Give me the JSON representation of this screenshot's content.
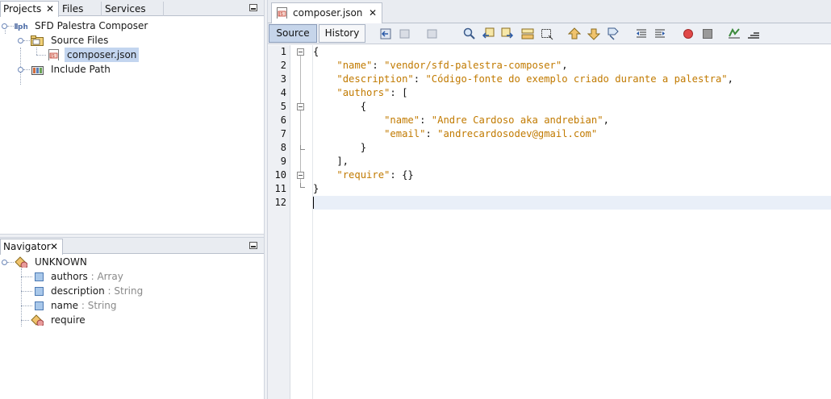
{
  "projects_panel": {
    "tabs": [
      {
        "label": "Projects",
        "close": "✕"
      },
      {
        "label": "Files"
      },
      {
        "label": "Services"
      }
    ],
    "tree": {
      "project": "SFD Palestra Composer",
      "source_files": "Source Files",
      "file": "composer.json",
      "include_path": "Include Path"
    }
  },
  "navigator_panel": {
    "title": "Navigator",
    "close": "✕",
    "root": "UNKNOWN",
    "items": [
      {
        "name": "authors",
        "type": " : Array"
      },
      {
        "name": "description",
        "type": " : String"
      },
      {
        "name": "name",
        "type": " : String"
      },
      {
        "name": "require",
        "type": ""
      }
    ]
  },
  "editor": {
    "tab_label": "composer.json",
    "tab_close": "✕",
    "source_button": "Source",
    "history_button": "History",
    "line_numbers": [
      "1",
      "2",
      "3",
      "4",
      "5",
      "6",
      "7",
      "8",
      "9",
      "10",
      "11",
      "12"
    ],
    "lines": [
      "{",
      "    \"name\": \"vendor/sfd-palestra-composer\",",
      "    \"description\": \"Código-fonte do exemplo criado durante a palestra\",",
      "    \"authors\": [",
      "        {",
      "            \"name\": \"Andre Cardoso aka andrebian\",",
      "            \"email\": \"andrecardosodev@gmail.com\"",
      "        }",
      "    ],",
      "    \"require\": {}",
      "}",
      ""
    ],
    "current_line": 12,
    "colors": {
      "string": "#c17a00",
      "current_line_bg": "#e9eff8"
    }
  }
}
